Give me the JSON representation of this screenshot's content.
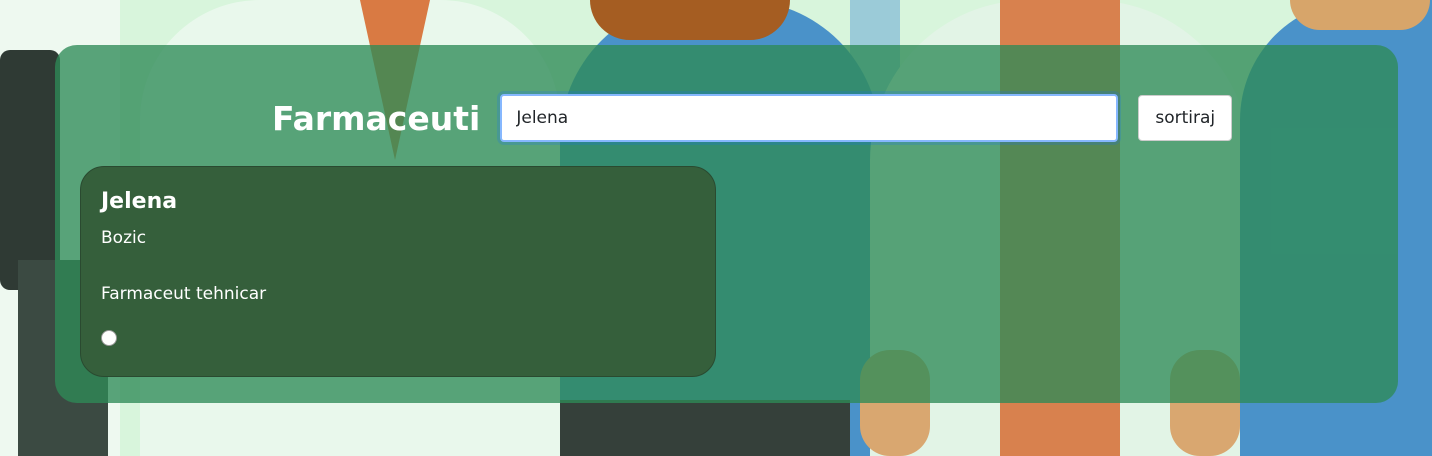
{
  "header": {
    "title": "Farmaceuti",
    "search_value": "Jelena",
    "sort_label": "sortiraj"
  },
  "results": [
    {
      "name": "Jelena",
      "surname": "Bozic",
      "role": "Farmaceut tehnicar"
    }
  ],
  "colors": {
    "overlay": "#2e8b57",
    "card": "#355f3b",
    "title_text": "#ffffff"
  }
}
